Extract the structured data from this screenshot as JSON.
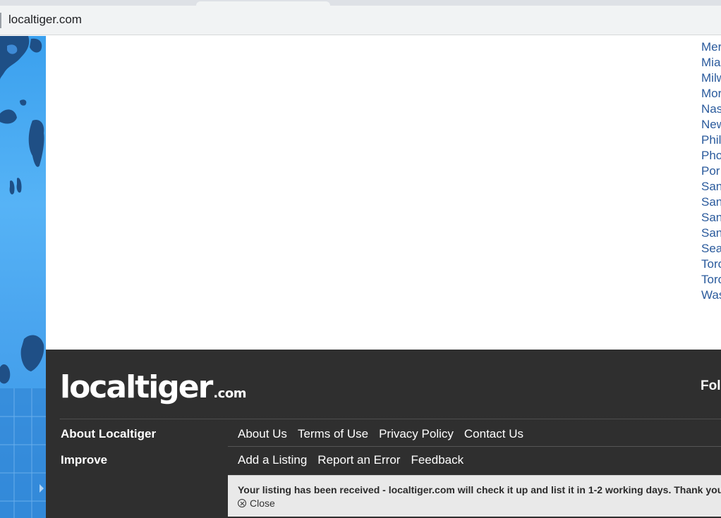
{
  "browser": {
    "url": "localtiger.com"
  },
  "cities": [
    "Mer",
    "Mia",
    "Milw",
    "Mor",
    "Nas",
    "New",
    "Phil",
    "Pho",
    "Por",
    "San",
    "San",
    "San",
    "San",
    "Sea",
    "Toro",
    "Toro",
    "Was"
  ],
  "footer": {
    "logo_name": "localtiger",
    "logo_tld": ".com",
    "follow_label": "Fol",
    "rows": [
      {
        "label": "About Localtiger",
        "links": [
          "About Us",
          "Terms of Use",
          "Privacy Policy",
          "Contact Us"
        ]
      },
      {
        "label": "Improve",
        "links": [
          "Add a Listing",
          "Report an Error",
          "Feedback"
        ]
      }
    ]
  },
  "notice": {
    "message": "Your listing has been received - localtiger.com will check it up and list it in 1-2 working days. Thank you!",
    "close_label": "Close",
    "close_icon": "close-circle-icon"
  },
  "colors": {
    "link_blue": "#2a5a9c",
    "footer_bg": "#2f2f2f",
    "map_blue": "#4aa5ef",
    "notice_bg": "#e9e9e9"
  }
}
